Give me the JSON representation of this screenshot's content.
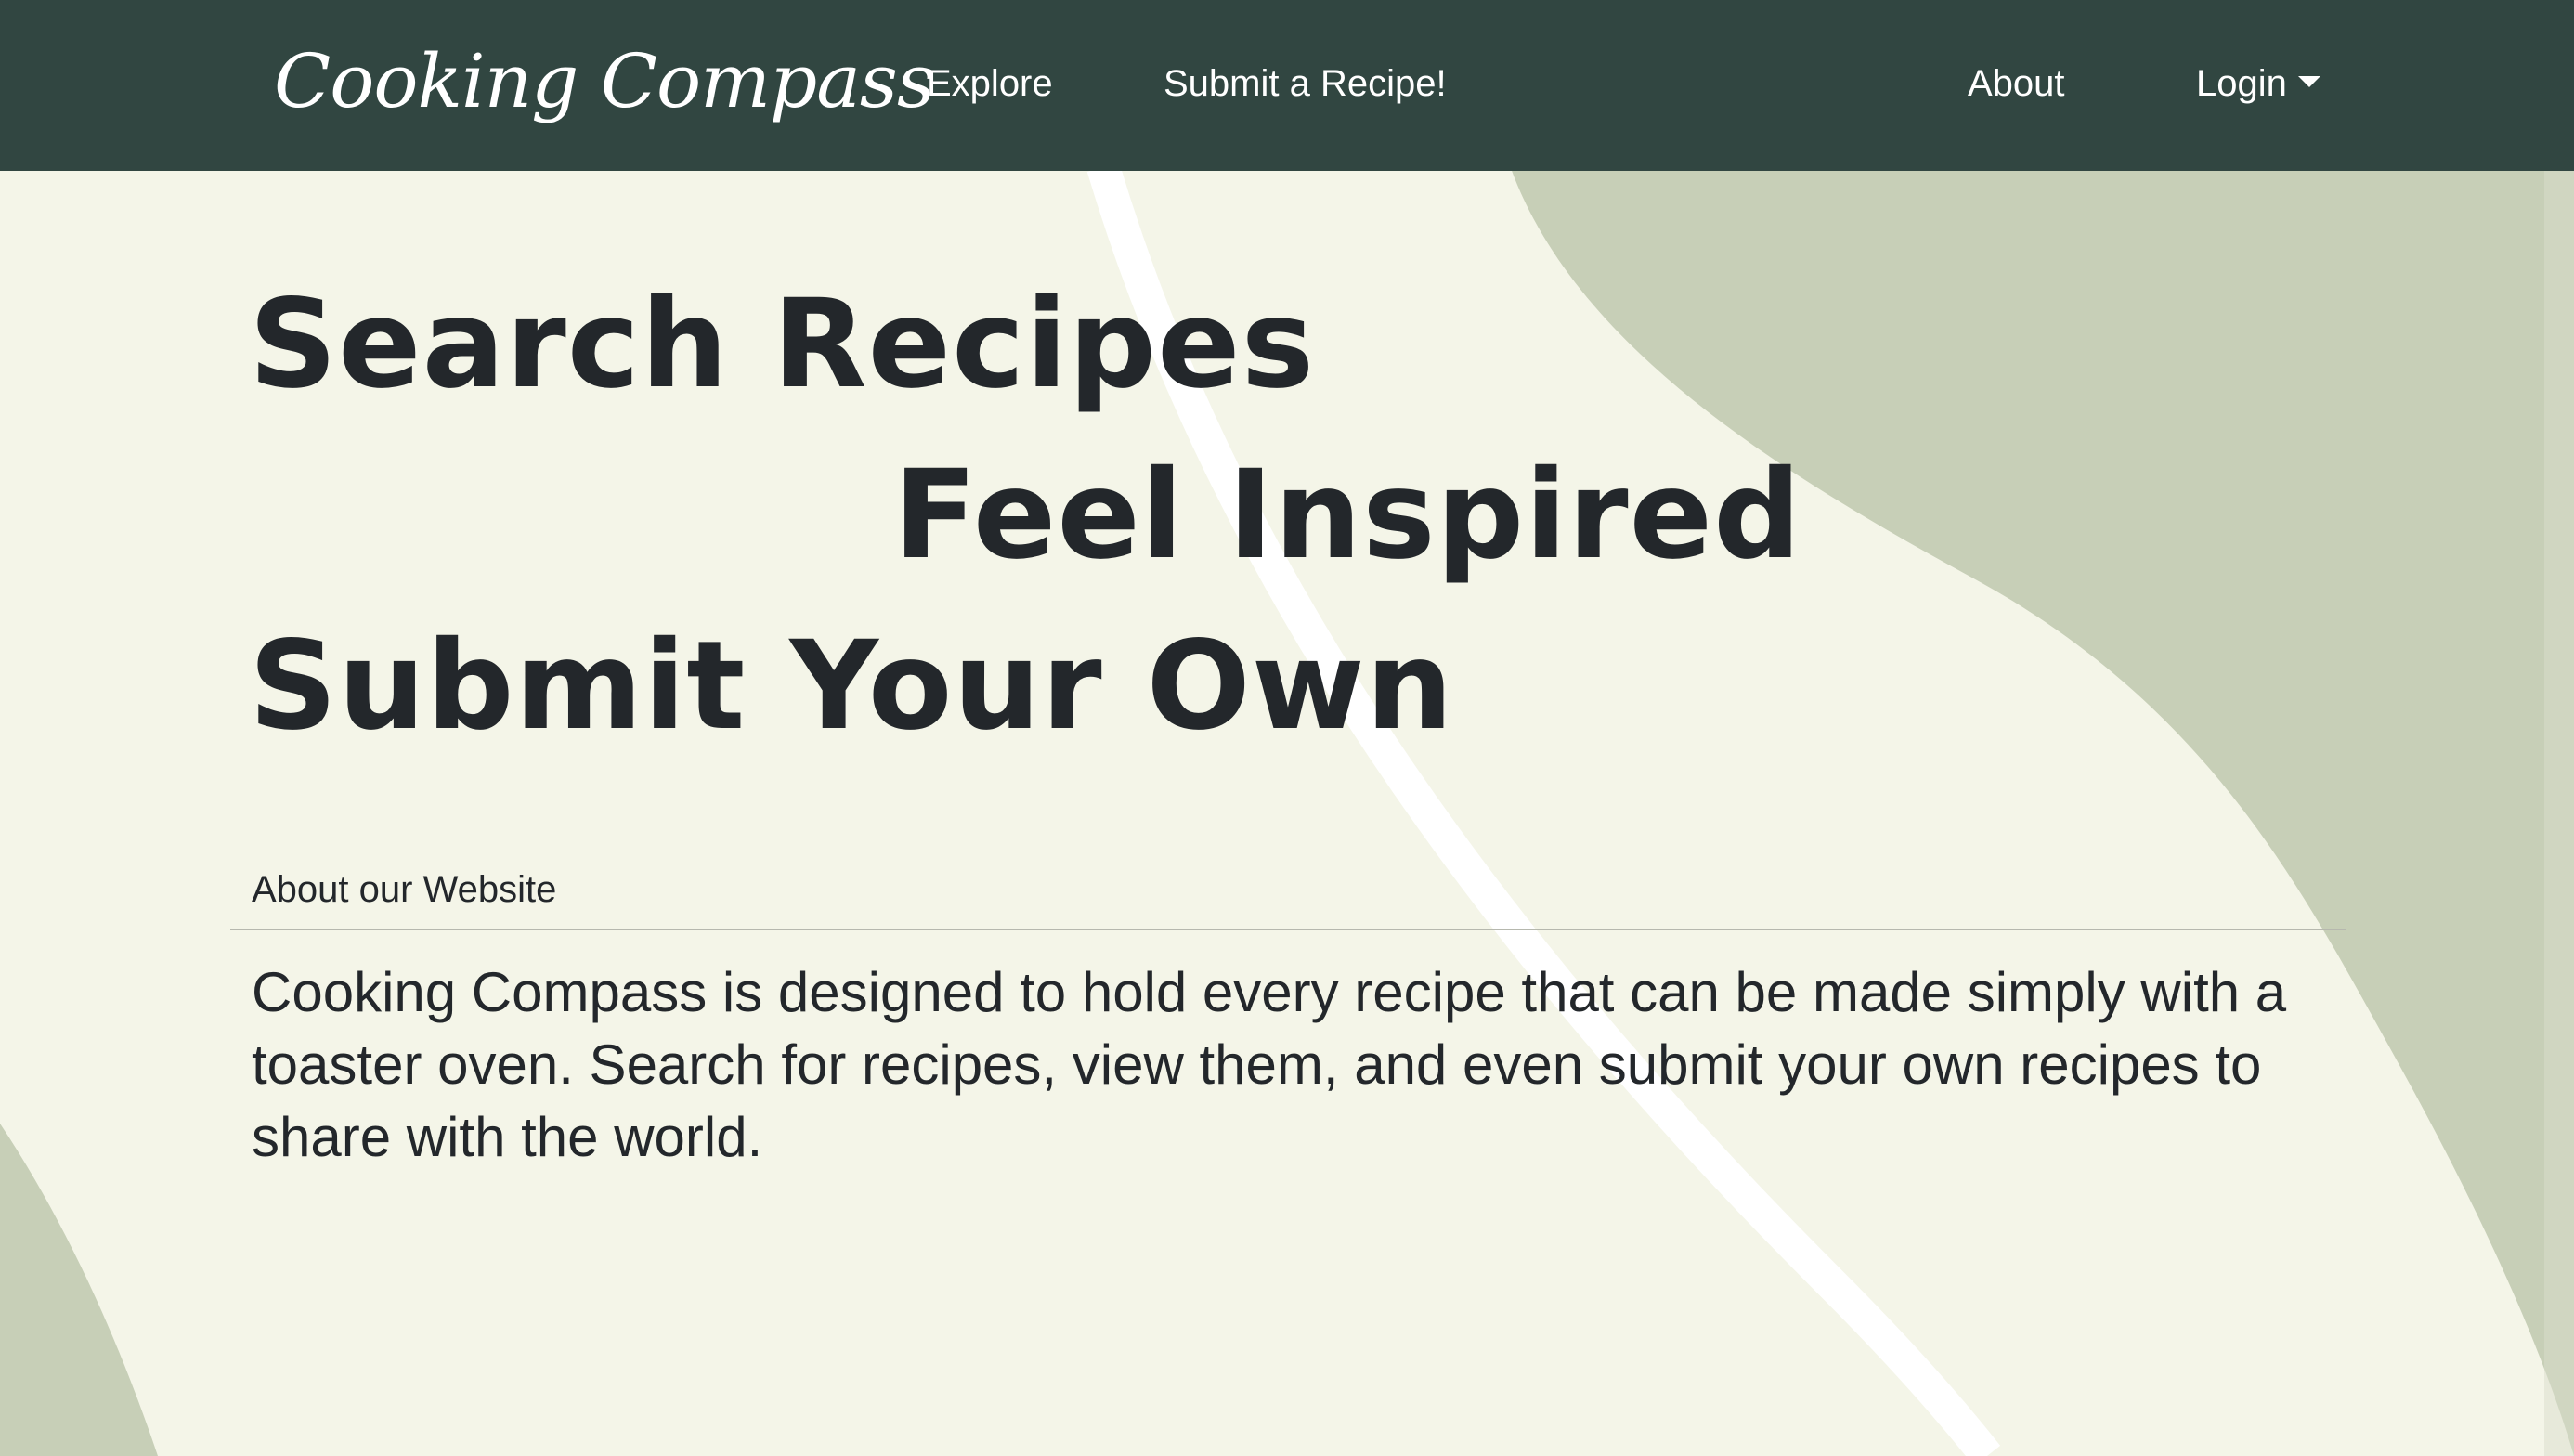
{
  "navbar": {
    "brand": "Cooking Compass",
    "explore": "Explore",
    "submit": "Submit a Recipe!",
    "about": "About",
    "login": "Login"
  },
  "hero": {
    "line1": "Search Recipes",
    "line2": "Feel Inspired",
    "line3": "Submit Your Own"
  },
  "about": {
    "heading": "About our Website",
    "body": "Cooking Compass is designed to hold every recipe that can be made simply with a toaster oven. Search for recipes, view them, and even submit your own recipes to share with the world."
  },
  "colors": {
    "navbar_bg": "#314641",
    "page_bg": "#f4f5e8",
    "shape_green": "#c7cfb7",
    "text_dark": "#23272b",
    "nav_text": "#ffffff",
    "stripe": "#ffffff"
  },
  "icons": {
    "login_dropdown": "caret-down-icon"
  }
}
